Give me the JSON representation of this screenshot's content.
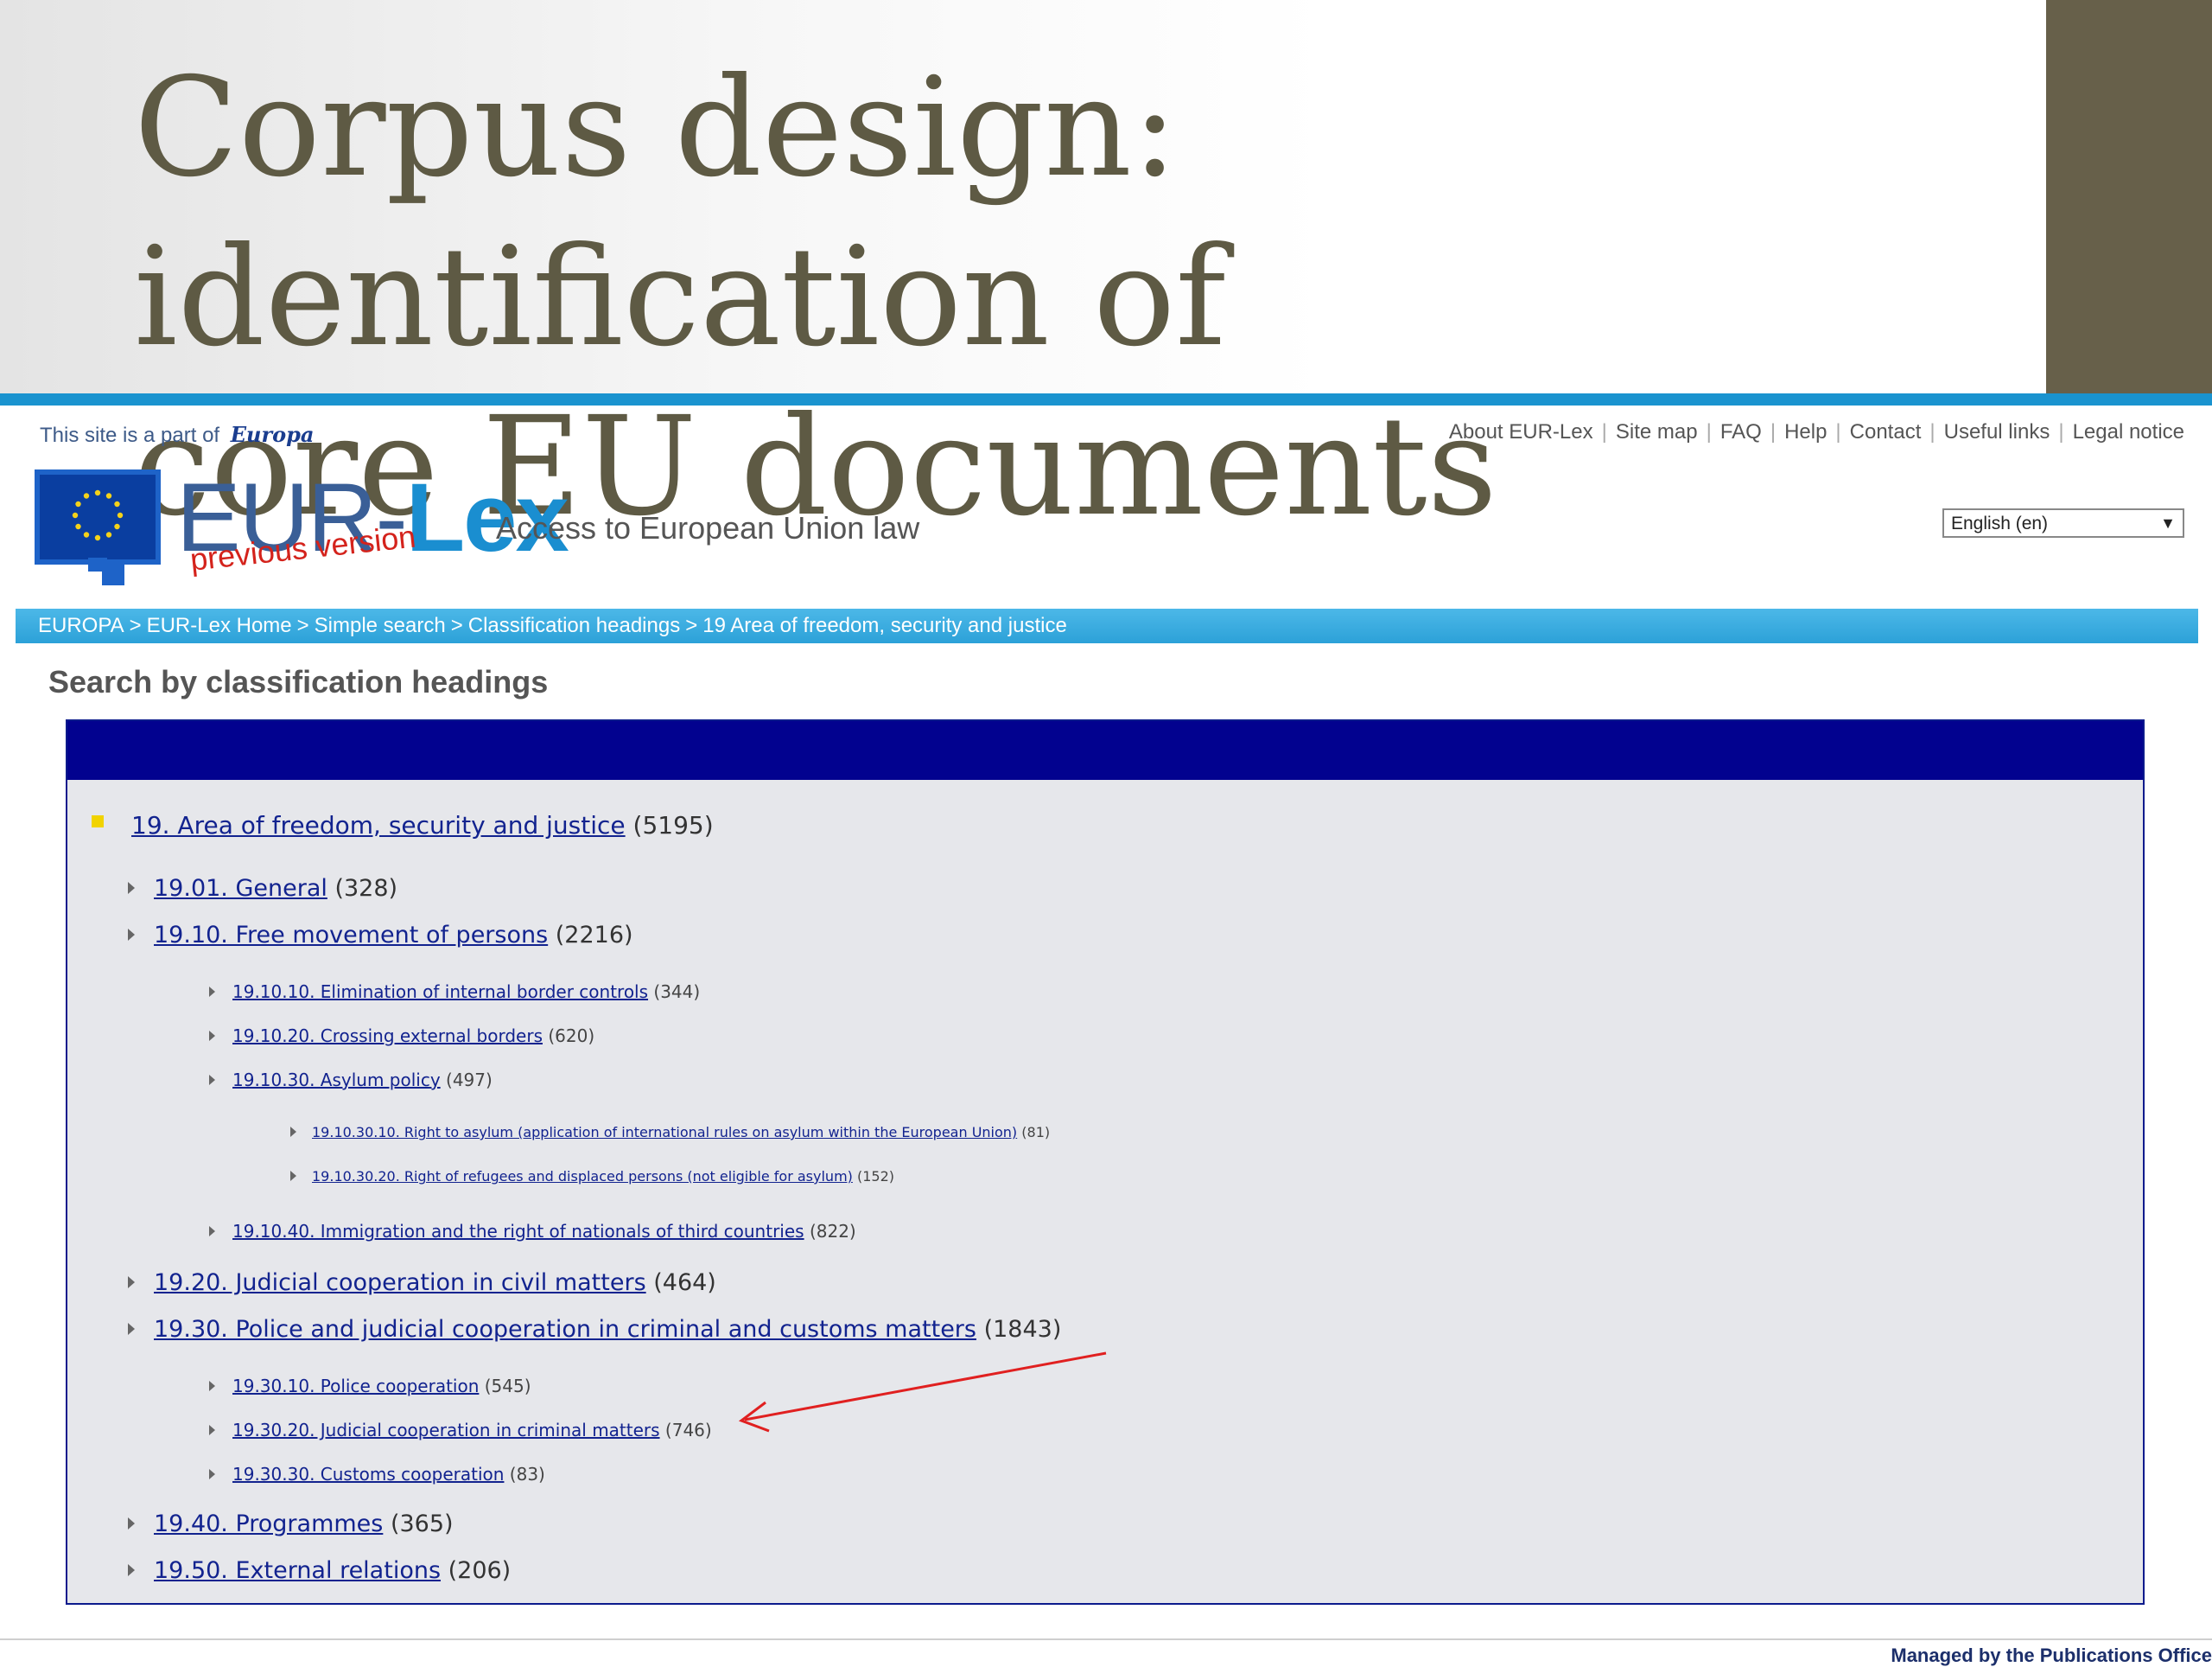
{
  "slide": {
    "title_line1": "Corpus design: identification of",
    "title_line2": "core EU documents"
  },
  "site": {
    "part_of_text": "This site is a part of",
    "europa_logo": "Europa",
    "logo_eur": "EUR-",
    "logo_lex": "Lex",
    "logo_previous": "previous version",
    "tagline": "Access to European Union law",
    "top_links": [
      "About EUR-Lex",
      "Site map",
      "FAQ",
      "Help",
      "Contact",
      "Useful links",
      "Legal notice"
    ],
    "language_selected": "English (en)"
  },
  "breadcrumb": [
    "EUROPA",
    "EUR-Lex Home",
    "Simple search",
    "Classification headings",
    "19 Area of freedom, security and justice"
  ],
  "page_title": "Search by classification headings",
  "tree": [
    {
      "label": "19. Area of freedom, security and justice",
      "count": "(5195)",
      "level": 0
    },
    {
      "label": "19.01. General",
      "count": "(328)",
      "level": 1
    },
    {
      "label": "19.10. Free movement of persons",
      "count": "(2216)",
      "level": 1
    },
    {
      "label": "19.10.10. Elimination of internal border controls",
      "count": "(344)",
      "level": 2
    },
    {
      "label": "19.10.20. Crossing external borders",
      "count": "(620)",
      "level": 2
    },
    {
      "label": "19.10.30. Asylum policy",
      "count": "(497)",
      "level": 2
    },
    {
      "label": "19.10.30.10. Right to asylum (application of international rules on asylum within the European Union)",
      "count": "(81)",
      "level": 3
    },
    {
      "label": "19.10.30.20. Right of refugees and displaced persons (not eligible for asylum)",
      "count": "(152)",
      "level": 3
    },
    {
      "label": "19.10.40. Immigration and the right of nationals of third countries",
      "count": "(822)",
      "level": 2
    },
    {
      "label": "19.20. Judicial cooperation in civil matters",
      "count": "(464)",
      "level": 1
    },
    {
      "label": "19.30. Police and judicial cooperation in criminal and customs matters",
      "count": "(1843)",
      "level": 1
    },
    {
      "label": "19.30.10. Police cooperation",
      "count": "(545)",
      "level": 2
    },
    {
      "label": "19.30.20. Judicial cooperation in criminal matters",
      "count": "(746)",
      "level": 2
    },
    {
      "label": "19.30.30. Customs cooperation",
      "count": "(83)",
      "level": 2
    },
    {
      "label": "19.40. Programmes",
      "count": "(365)",
      "level": 1
    },
    {
      "label": "19.50. External relations",
      "count": "(206)",
      "level": 1
    }
  ],
  "footer": "Managed by the Publications Office",
  "colors": {
    "slide_title": "#5e5a44",
    "accent_block": "#67604a",
    "rule_blue": "#1a93cf",
    "tree_header": "#02028f",
    "link": "#12238f",
    "annotation_arrow": "#e02020"
  }
}
